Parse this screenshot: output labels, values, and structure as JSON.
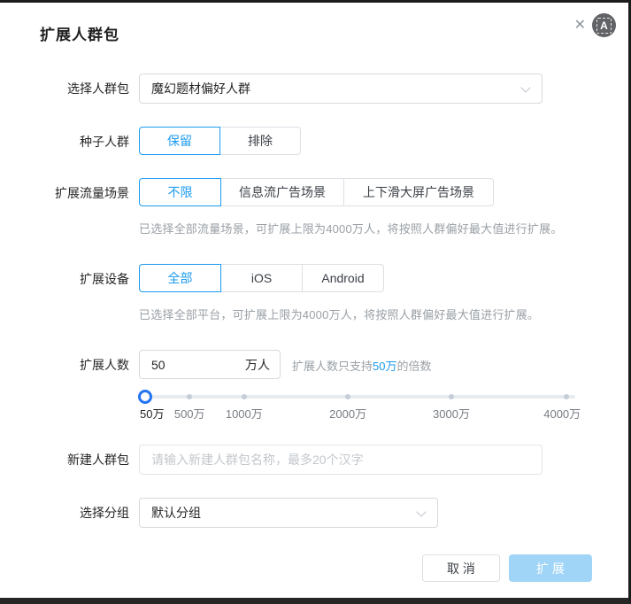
{
  "colors": {
    "accent": "#1c9bef",
    "slider_handle": "#2474f2",
    "confirm_disabled_bg": "#a0d5f7"
  },
  "dialog": {
    "title": "扩展人群包"
  },
  "icons": {
    "close": "✕",
    "badge_letter": "A"
  },
  "form": {
    "package": {
      "label": "选择人群包",
      "value": "魔幻题材偏好人群"
    },
    "seed": {
      "label": "种子人群",
      "options": [
        "保留",
        "排除"
      ],
      "selected": "保留"
    },
    "scene": {
      "label": "扩展流量场景",
      "options": [
        "不限",
        "信息流广告场景",
        "上下滑大屏广告场景"
      ],
      "selected": "不限",
      "helper": "已选择全部流量场景，可扩展上限为4000万人，将按照人群偏好最大值进行扩展。"
    },
    "device": {
      "label": "扩展设备",
      "options": [
        "全部",
        "iOS",
        "Android"
      ],
      "selected": "全部",
      "helper": "已选择全部平台，可扩展上限为4000万人，将按照人群偏好最大值进行扩展。"
    },
    "count": {
      "label": "扩展人数",
      "value": "50",
      "unit": "万人",
      "helper_prefix": "扩展人数只支持",
      "helper_highlight": "50万",
      "helper_suffix": "的倍数"
    },
    "slider": {
      "marks": [
        "50万",
        "500万",
        "1000万",
        "2000万",
        "3000万",
        "4000万"
      ],
      "current": "50万"
    },
    "new_package": {
      "label": "新建人群包",
      "placeholder": "请输入新建人群包名称，最多20个汉字"
    },
    "group": {
      "label": "选择分组",
      "value": "默认分组"
    }
  },
  "footer": {
    "cancel": "取 消",
    "confirm": "扩 展"
  }
}
